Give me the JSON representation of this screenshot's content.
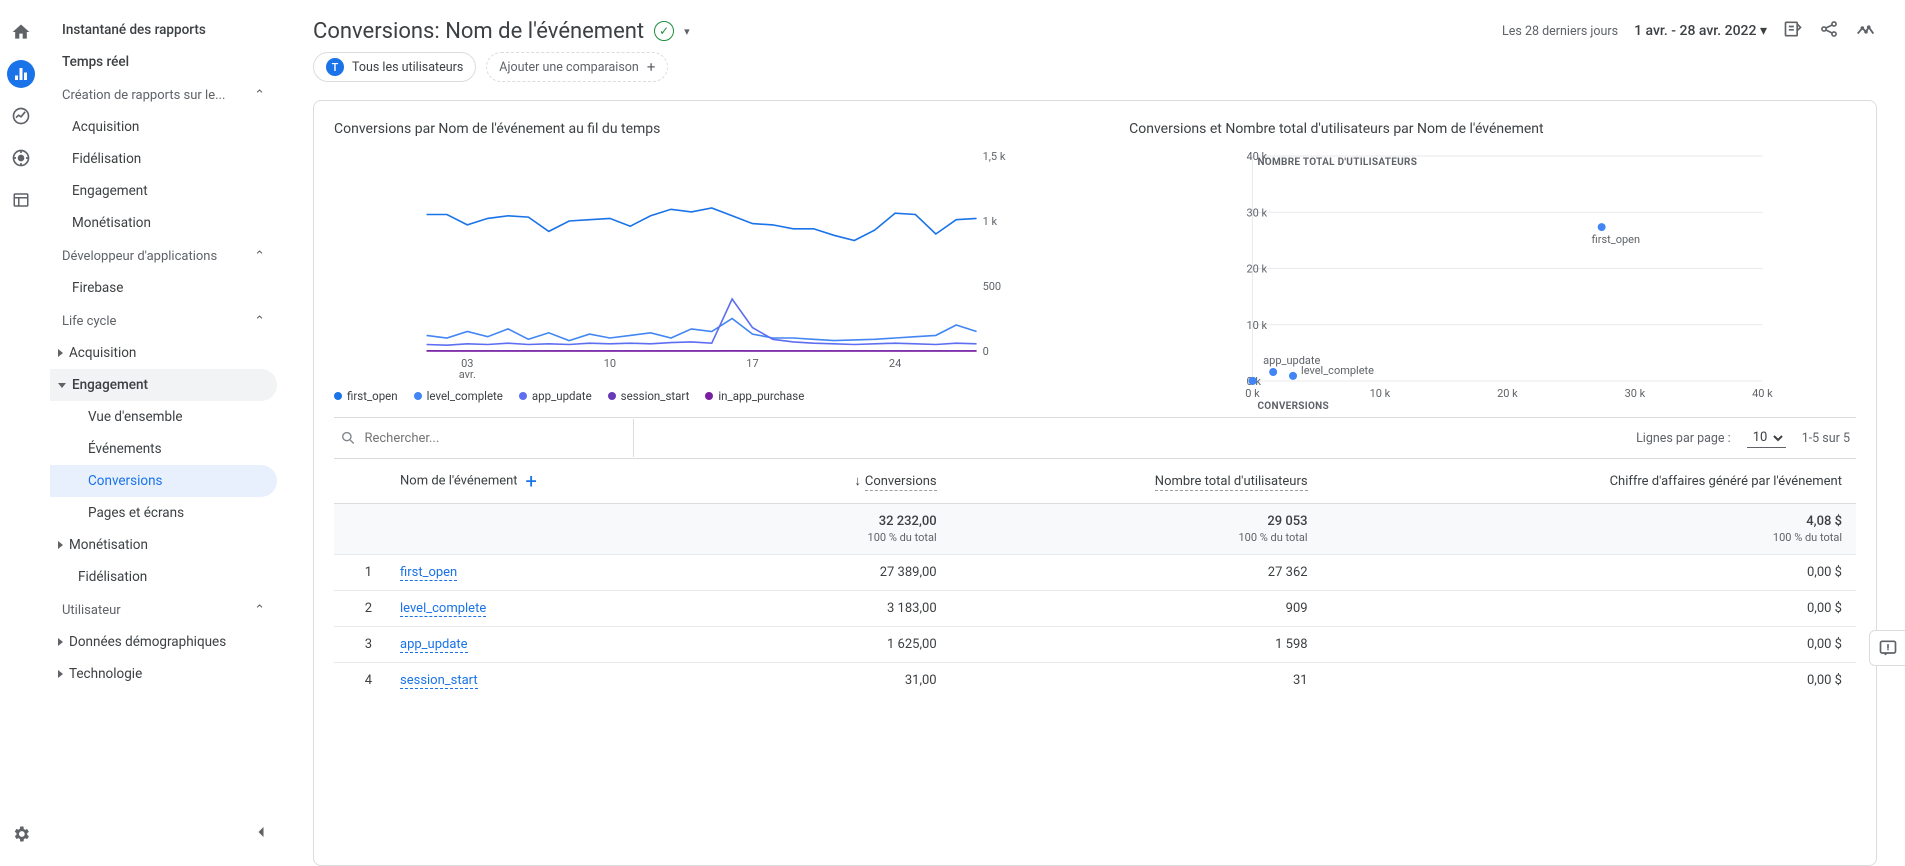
{
  "rail_icons": [
    "home",
    "reports",
    "analysis",
    "explore",
    "table",
    "settings"
  ],
  "nav": {
    "top_items": [
      "Instantané des rapports",
      "Temps réel"
    ],
    "section_reports": {
      "label": "Création de rapports sur le...",
      "items": [
        "Acquisition",
        "Fidélisation",
        "Engagement",
        "Monétisation"
      ]
    },
    "section_dev": {
      "label": "Développeur d'applications",
      "items": [
        "Firebase"
      ]
    },
    "section_lifecycle": {
      "label": "Life cycle",
      "items": [
        {
          "label": "Acquisition"
        },
        {
          "label": "Engagement",
          "children": [
            "Vue d'ensemble",
            "Événements",
            "Conversions",
            "Pages et écrans"
          ],
          "selected": "Conversions"
        },
        {
          "label": "Monétisation"
        },
        {
          "label": "Fidélisation"
        }
      ]
    },
    "section_user": {
      "label": "Utilisateur",
      "items": [
        "Données démographiques",
        "Technologie"
      ]
    }
  },
  "header": {
    "title": "Conversions: Nom de l'événement",
    "period_label": "Les 28 derniers jours",
    "date_range": "1 avr. - 28 avr. 2022"
  },
  "chips": {
    "all_users_label": "Tous les utilisateurs",
    "add_comparison_label": "Ajouter une comparaison"
  },
  "chart1_title": "Conversions par Nom de l'événement au fil du temps",
  "chart2_title": "Conversions et Nombre total d'utilisateurs par Nom de l'événement",
  "legend": [
    "first_open",
    "level_complete",
    "app_update",
    "session_start",
    "in_app_purchase"
  ],
  "colors": {
    "first_open": "#1a73e8",
    "level_complete": "#4285f4",
    "app_update": "#5e6ef0",
    "session_start": "#673ab7",
    "in_app_purchase": "#7b1fa2"
  },
  "table": {
    "search_placeholder": "Rechercher...",
    "rows_label": "Lignes par page :",
    "rows_per_page": "10",
    "range_label": "1-5 sur 5",
    "col_name": "Nom de l'événement",
    "col_conv": "Conversions",
    "col_users": "Nombre total d'utilisateurs",
    "col_revenue": "Chiffre d'affaires généré par l'événement",
    "totals": {
      "conv": "32 232,00",
      "conv_pct": "100 % du total",
      "users": "29 053",
      "users_pct": "100 % du total",
      "rev": "4,08 $",
      "rev_pct": "100 % du total"
    },
    "rows": [
      {
        "idx": "1",
        "name": "first_open",
        "conv": "27 389,00",
        "users": "27 362",
        "rev": "0,00 $"
      },
      {
        "idx": "2",
        "name": "level_complete",
        "conv": "3 183,00",
        "users": "909",
        "rev": "0,00 $"
      },
      {
        "idx": "3",
        "name": "app_update",
        "conv": "1 625,00",
        "users": "1 598",
        "rev": "0,00 $"
      },
      {
        "idx": "4",
        "name": "session_start",
        "conv": "31,00",
        "users": "31",
        "rev": "0,00 $"
      }
    ]
  },
  "chart_data": [
    {
      "type": "line",
      "title": "Conversions par Nom de l'événement au fil du temps",
      "xlabel": "",
      "ylabel": "",
      "ylim": [
        0,
        1500
      ],
      "x_ticks": [
        "03 avr.",
        "10",
        "17",
        "24"
      ],
      "y_ticks": [
        0,
        500,
        1000,
        1500
      ],
      "x": [
        1,
        2,
        3,
        4,
        5,
        6,
        7,
        8,
        9,
        10,
        11,
        12,
        13,
        14,
        15,
        16,
        17,
        18,
        19,
        20,
        21,
        22,
        23,
        24,
        25,
        26,
        27,
        28
      ],
      "series": [
        {
          "name": "first_open",
          "color": "#1a73e8",
          "values": [
            1050,
            1050,
            970,
            1020,
            1040,
            1030,
            920,
            1000,
            1010,
            1020,
            960,
            1040,
            1090,
            1070,
            1100,
            1040,
            980,
            970,
            940,
            940,
            890,
            850,
            930,
            1060,
            1050,
            900,
            1010,
            1020
          ]
        },
        {
          "name": "level_complete",
          "color": "#4285f4",
          "values": [
            120,
            100,
            150,
            110,
            170,
            90,
            140,
            80,
            130,
            100,
            120,
            140,
            100,
            170,
            150,
            250,
            130,
            100,
            100,
            90,
            80,
            85,
            90,
            100,
            110,
            120,
            200,
            150
          ]
        },
        {
          "name": "app_update",
          "color": "#5e6ef0",
          "values": [
            50,
            45,
            55,
            50,
            60,
            50,
            55,
            50,
            60,
            55,
            60,
            55,
            65,
            70,
            60,
            400,
            180,
            90,
            70,
            60,
            55,
            50,
            55,
            60,
            55,
            50,
            60,
            55
          ]
        },
        {
          "name": "session_start",
          "color": "#673ab7",
          "values": [
            2,
            1,
            1,
            1,
            1,
            1,
            1,
            1,
            1,
            1,
            1,
            1,
            1,
            1,
            1,
            2,
            1,
            1,
            1,
            1,
            1,
            1,
            1,
            1,
            1,
            1,
            1,
            1
          ]
        },
        {
          "name": "in_app_purchase",
          "color": "#7b1fa2",
          "values": [
            0,
            0,
            0,
            0,
            0,
            0,
            0,
            0,
            0,
            0,
            0,
            0,
            0,
            0,
            0,
            0,
            0,
            0,
            0,
            0,
            0,
            0,
            0,
            0,
            0,
            0,
            0,
            0
          ]
        }
      ]
    },
    {
      "type": "scatter",
      "title": "Conversions et Nombre total d'utilisateurs par Nom de l'événement",
      "xlabel": "CONVERSIONS",
      "ylabel": "NOMBRE TOTAL D'UTILISATEURS",
      "xlim": [
        0,
        40000
      ],
      "ylim": [
        0,
        40000
      ],
      "x_ticks": [
        0,
        10000,
        20000,
        30000,
        40000
      ],
      "y_ticks": [
        0,
        10000,
        20000,
        30000,
        40000
      ],
      "points": [
        {
          "name": "first_open",
          "x": 27389,
          "y": 27362
        },
        {
          "name": "level_complete",
          "x": 3183,
          "y": 909
        },
        {
          "name": "app_update",
          "x": 1625,
          "y": 1598
        },
        {
          "name": "session_start",
          "x": 31,
          "y": 31
        },
        {
          "name": "in_app_purchase",
          "x": 4,
          "y": 4
        }
      ]
    }
  ]
}
